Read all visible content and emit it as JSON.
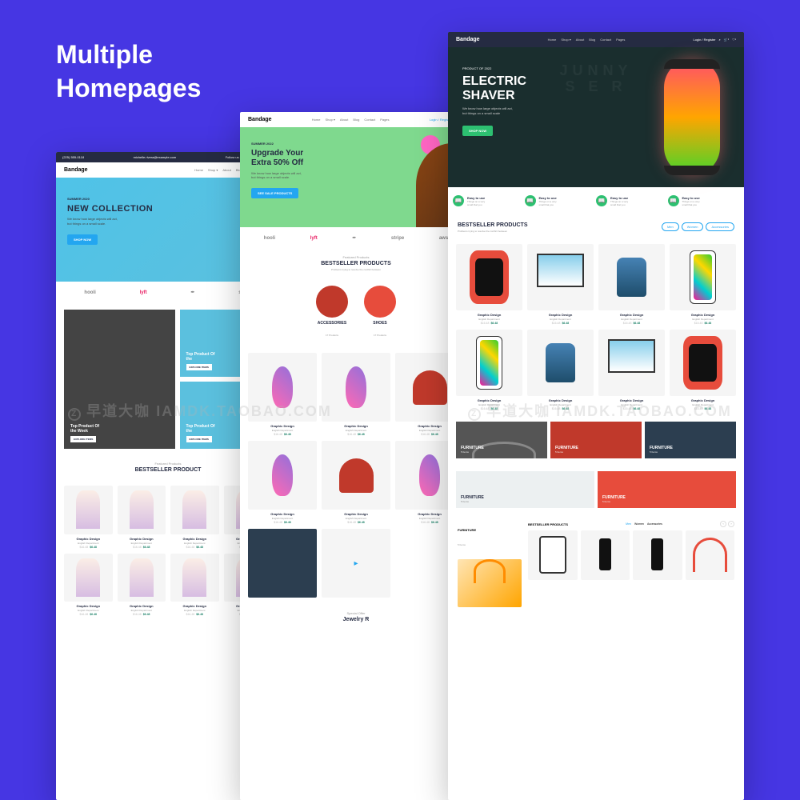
{
  "main_heading": "Multiple\nHomepages",
  "brand": "Bandage",
  "nav": {
    "items": [
      "Home",
      "Shop",
      "About",
      "Blog",
      "Contact",
      "Pages"
    ],
    "shop": "Shop ▾",
    "login": "Login / Register"
  },
  "topbar": {
    "phone": "(225) 555-0118",
    "email": "michelle.rivera@example.com",
    "follow": "Follow us and get a chance to win"
  },
  "hero1": {
    "tag": "SUMMER 2020",
    "title": "NEW COLLECTION",
    "desc": "We know how large objects will act,\nbut things on a small scale.",
    "cta": "SHOP NOW"
  },
  "hero2": {
    "tag": "SUMMER 2022",
    "title": "Upgrade Your\nExtra 50% Off",
    "desc": "We know how large objects will act,\nbut things on a small scale.",
    "cta": "SEE SALE PRODUCTS"
  },
  "hero3": {
    "bg": "JUNNY\nS E R",
    "tag": "PRODUCT OF 2022",
    "title": "ELECTRIC\nSHAVER",
    "desc": "We know how large objects will act,\nbut things on a small scale",
    "cta": "SHOP NOW"
  },
  "features": [
    {
      "title": "Easy to use",
      "desc": "Things on a very\nsmall that you"
    },
    {
      "title": "Easy to use",
      "desc": "Things on a very\nsmall that you"
    },
    {
      "title": "Easy to use",
      "desc": "Things on a very\nsmall that you"
    },
    {
      "title": "Easy to use",
      "desc": "Things on a very\nsmall that you"
    }
  ],
  "brands_row": [
    "hooli",
    "lyft",
    "✒",
    "stripe",
    "aws"
  ],
  "brands_row4": [
    "hooli",
    "lyft",
    "✒",
    "stripe"
  ],
  "section": {
    "eyebrow": "Featured Products",
    "title": "BESTSELLER PRODUCTS",
    "title2": "BESTSELLER PRODUCT",
    "desc": "Problems trying to resolve the conflict between"
  },
  "filters": [
    "Men",
    "Women",
    "Accessories"
  ],
  "cats": [
    {
      "name": "ACCESSORIES",
      "count": "17 Products"
    },
    {
      "name": "SHOES",
      "count": "17 Products"
    }
  ],
  "product": {
    "name": "Graphic Design",
    "dept": "English Department",
    "old": "$16.48",
    "new": "$6.48"
  },
  "fashion_tiles": {
    "main": "Top Product Of\nthe Week",
    "btn": "EXPLORE ITEMS",
    "side": "Top Product Of\nthe"
  },
  "furniture": {
    "label": "FURNITURE",
    "count": "5 Items"
  },
  "special": {
    "eyebrow": "Special Offer",
    "title": "Jewelry R"
  },
  "sidebar": {
    "title": "FURNITURE",
    "count": "5 Items",
    "best": "BESTSELLER PRODUCTS",
    "tabs": [
      "Men",
      "Women",
      "Accessories"
    ]
  },
  "watermark": {
    "mark": "早道大咖",
    "url": "IAMDK.TAOBAO.COM",
    "z": "Z"
  }
}
